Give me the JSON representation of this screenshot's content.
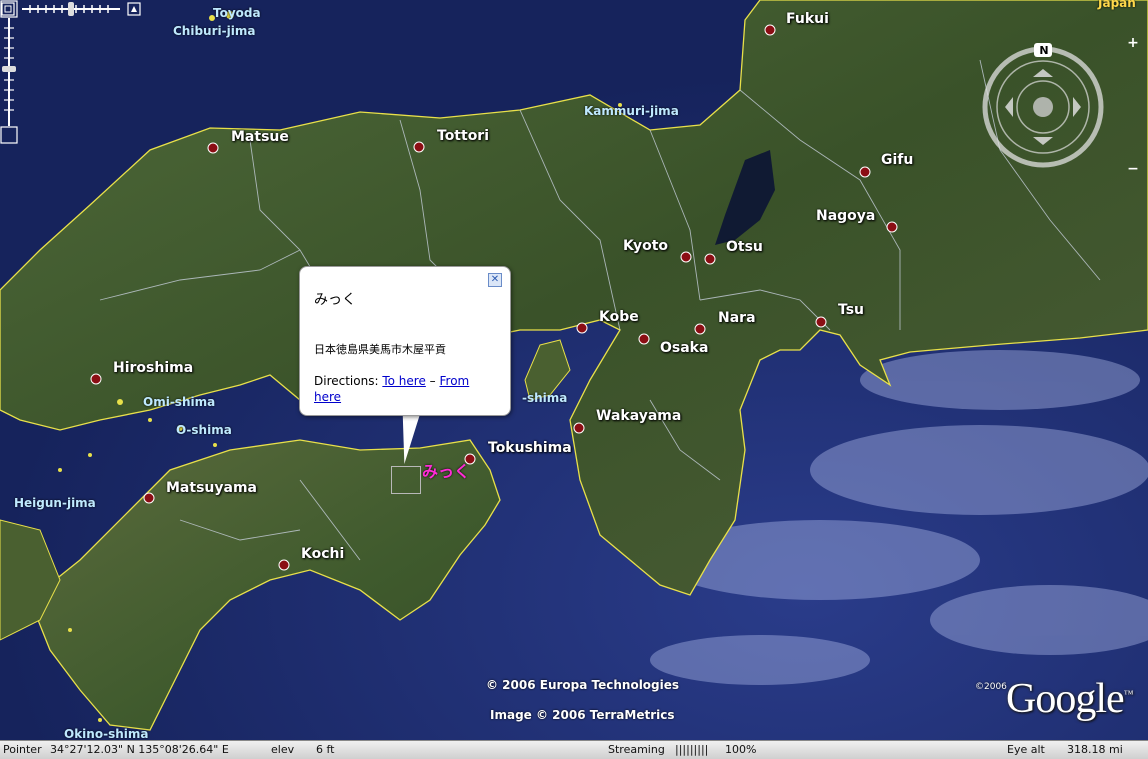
{
  "cities": [
    {
      "name": "Fukui"
    },
    {
      "name": "Matsue"
    },
    {
      "name": "Tottori"
    },
    {
      "name": "Gifu"
    },
    {
      "name": "Nagoya"
    },
    {
      "name": "Kyoto"
    },
    {
      "name": "Otsu"
    },
    {
      "name": "Kobe"
    },
    {
      "name": "Nara"
    },
    {
      "name": "Osaka"
    },
    {
      "name": "Tsu"
    },
    {
      "name": "Hiroshima"
    },
    {
      "name": "Wakayama"
    },
    {
      "name": "Tokushima"
    },
    {
      "name": "Matsuyama"
    },
    {
      "name": "Kochi"
    }
  ],
  "islands": [
    "Toyoda",
    "Chiburi-jima",
    "Kammuri-jima",
    "Omi-shima",
    "O-shima",
    "Heigun-jima",
    "Okino-shima",
    "-shima"
  ],
  "country_label": "Japan",
  "placemark": {
    "label": "みっく",
    "color": "#ff2bd6"
  },
  "balloon": {
    "title": "みっく",
    "address": "日本徳島県美馬市木屋平貢",
    "directions_label": "Directions:",
    "to_here": "To here",
    "separator": "–",
    "from_here": "From here",
    "close_icon": "close-icon"
  },
  "navigation": {
    "compass_north": "N",
    "zoom_in": "+",
    "zoom_out": "−"
  },
  "attribution": {
    "europa": "© 2006 Europa Technologies",
    "terrametrics": "Image © 2006 TerraMetrics",
    "logo": "Google",
    "logo_copyright": "©2006",
    "logo_tm": "™"
  },
  "status_bar": {
    "pointer_label": "Pointer",
    "pointer_value": "34°27'12.03\" N  135°08'26.64\" E",
    "elev_label": "elev",
    "elev_value": "6 ft",
    "streaming_label": "Streaming",
    "streaming_bar": "|||||||||",
    "streaming_value": "100%",
    "eye_alt_label": "Eye alt",
    "eye_alt_value": "318.18 mi"
  },
  "colors": {
    "ocean": "#1b2a6b",
    "land": "#3d5a2c",
    "coastline": "#e8e04a",
    "city_dot": "#8b0e14",
    "link": "#0000cc"
  }
}
